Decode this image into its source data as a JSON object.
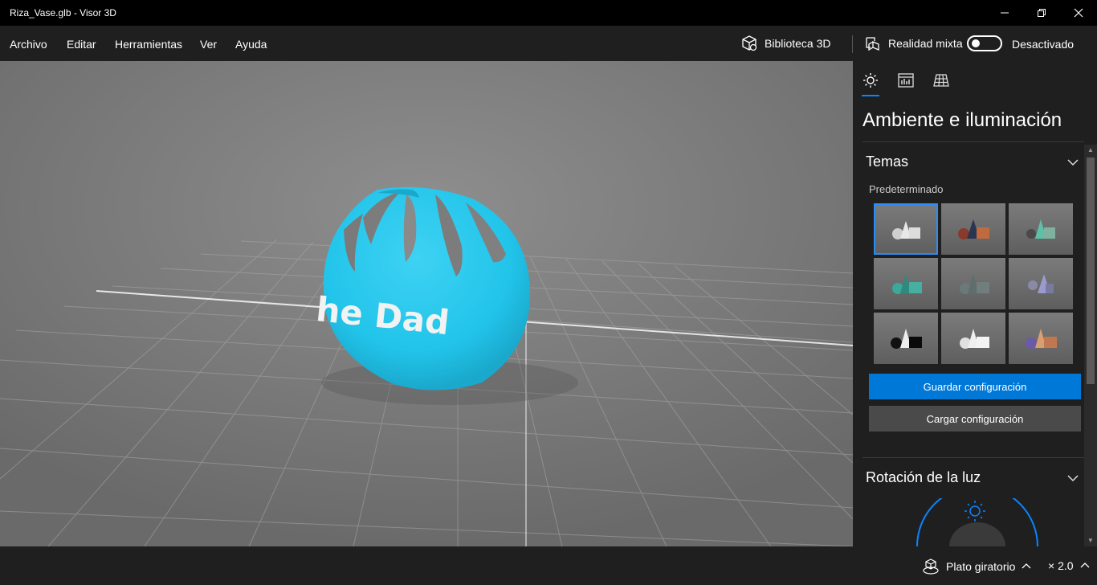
{
  "window": {
    "title": "Riza_Vase.glb - Visor 3D",
    "minimize_glyph": "—",
    "maximize_glyph": "❐",
    "close_glyph": "✕"
  },
  "menu": {
    "items": [
      "Archivo",
      "Editar",
      "Herramientas",
      "Ver",
      "Ayuda"
    ],
    "library_label": "Biblioteca 3D",
    "mixed_reality_label": "Realidad mixta",
    "mixed_reality_state": "Desactivado",
    "mixed_reality_on": false
  },
  "viewport": {
    "model_text": "he Dad",
    "model_color": "#22c4ea"
  },
  "panel": {
    "tabs": [
      "sun-icon",
      "stats-icon",
      "grid-icon"
    ],
    "active_tab": 0,
    "title": "Ambiente e iluminación",
    "themes_section": "Temas",
    "preset_label": "Predeterminado",
    "selected_theme": 0,
    "save_button": "Guardar configuración",
    "load_button": "Cargar configuración",
    "light_rotation_section": "Rotación de la luz"
  },
  "bottom": {
    "turntable_label": "Plato giratorio",
    "speed_label": "× 2.0"
  },
  "colors": {
    "accent": "#0078d7",
    "panel_bg": "#1f1f1f",
    "viewport_bg": "#7a7a7a"
  }
}
